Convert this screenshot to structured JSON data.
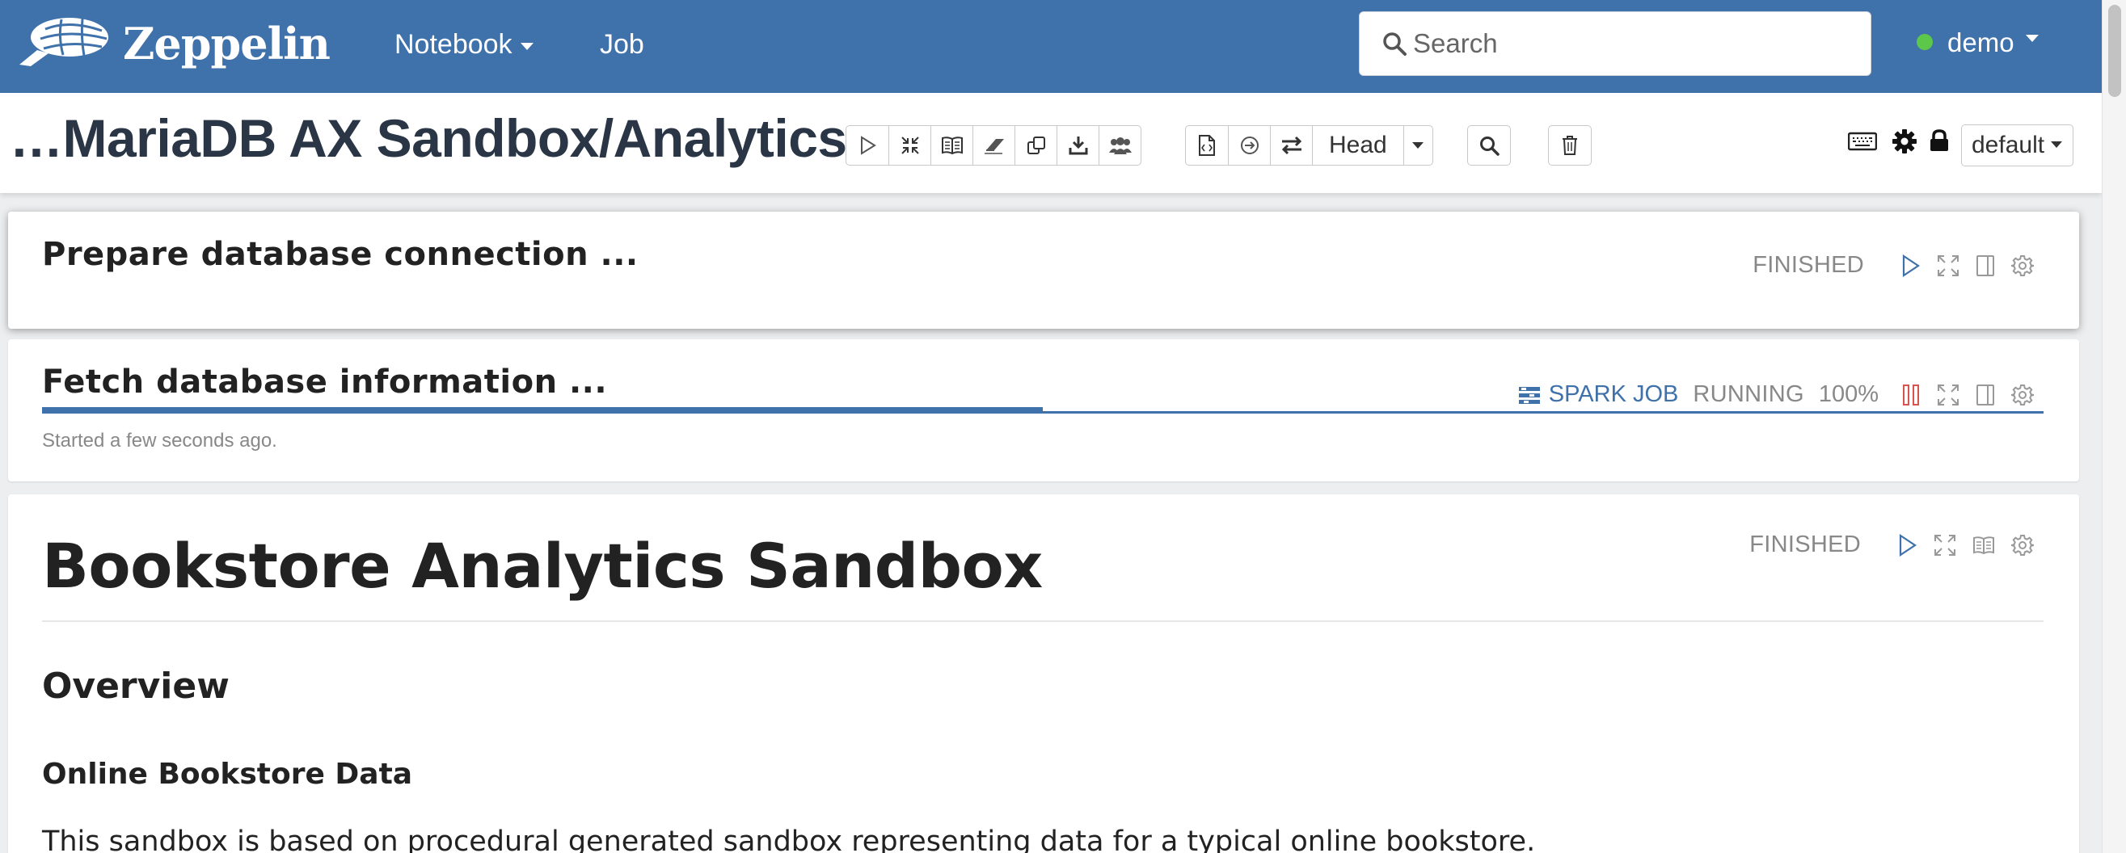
{
  "navbar": {
    "brand": "Zeppelin",
    "notebook_label": "Notebook",
    "job_label": "Job",
    "search_placeholder": "Search",
    "user": "demo"
  },
  "header": {
    "title": "…MariaDB AX Sandbox/Analytics",
    "version_label": "Head",
    "interpreter": "default"
  },
  "paragraphs": [
    {
      "title": "Prepare database connection ...",
      "status": "FINISHED"
    },
    {
      "title": "Fetch database information ...",
      "job_label": "SPARK JOB",
      "status": "RUNNING",
      "progress_text": "100%",
      "progress": 0.5,
      "started": "Started a few seconds ago."
    },
    {
      "status": "FINISHED",
      "h1": "Bookstore Analytics Sandbox",
      "h2": "Overview",
      "h3": "Online Bookstore Data",
      "text": "This sandbox is based on procedural generated sandbox representing data for a typical online bookstore."
    }
  ],
  "colors": {
    "navbar": "#3f71aa",
    "accent": "#3f71aa",
    "user_online": "#5cc74b",
    "pause": "#d9534f"
  }
}
